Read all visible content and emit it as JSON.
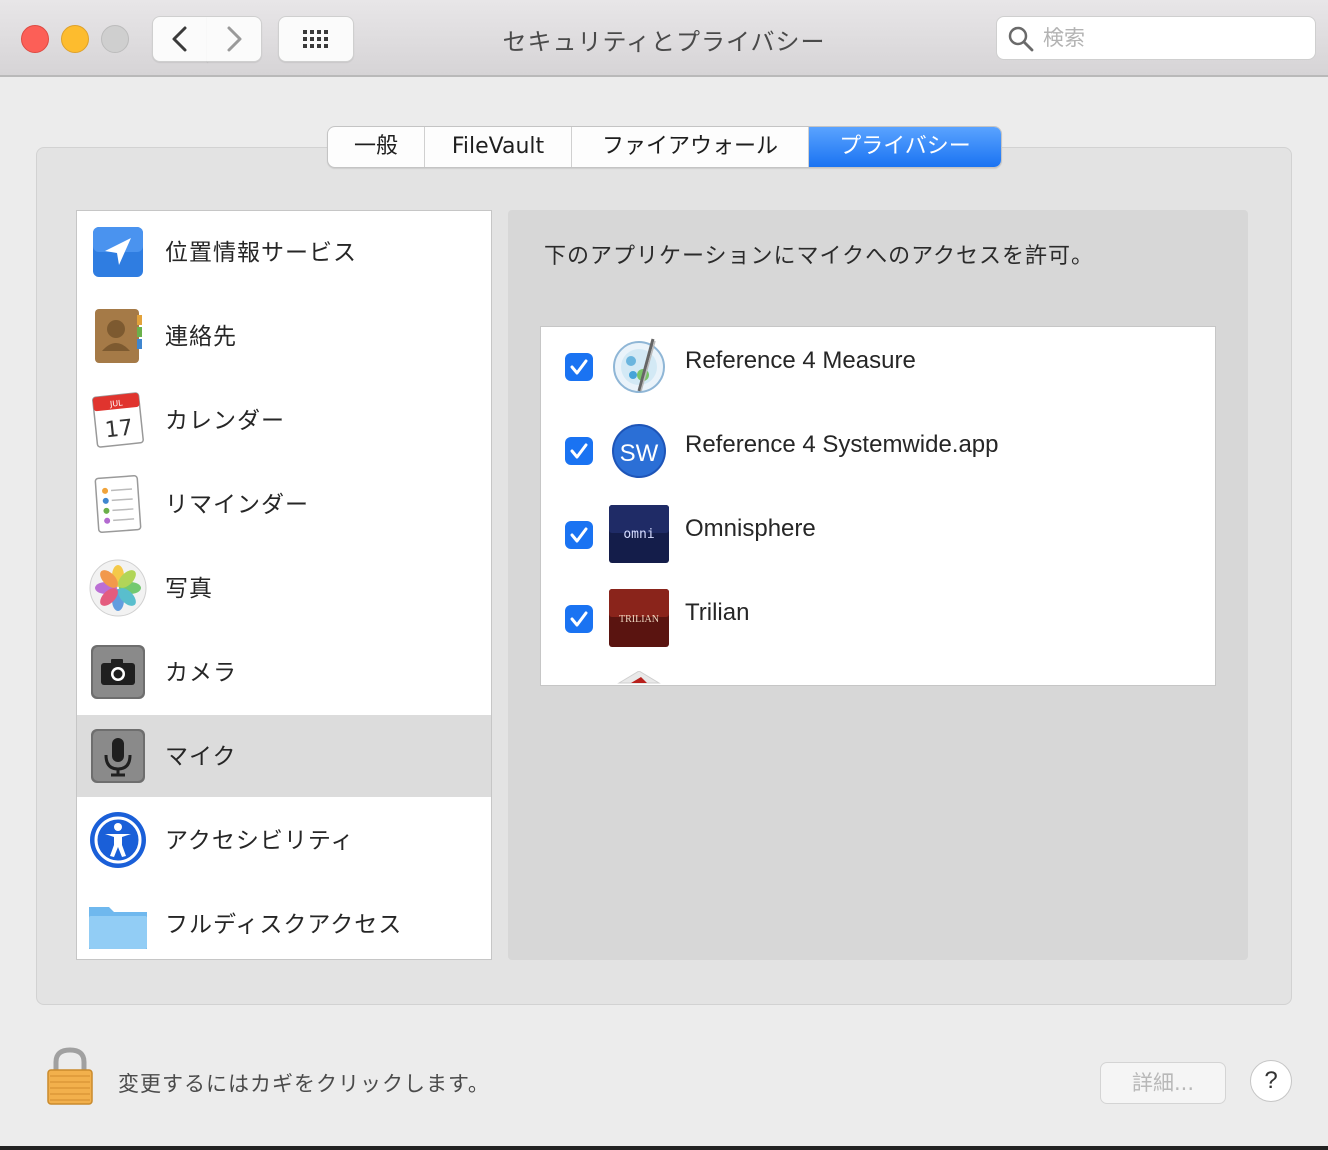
{
  "window": {
    "title": "セキュリティとプライバシー",
    "search_placeholder": "検索"
  },
  "tabs": [
    {
      "label": "一般",
      "active": false
    },
    {
      "label": "FileVault",
      "active": false
    },
    {
      "label": "ファイアウォール",
      "active": false
    },
    {
      "label": "プライバシー",
      "active": true
    }
  ],
  "categories": [
    {
      "label": "位置情報サービス",
      "icon": "location-arrow-icon"
    },
    {
      "label": "連絡先",
      "icon": "contacts-book-icon"
    },
    {
      "label": "カレンダー",
      "icon": "calendar-icon",
      "icon_text_month": "JUL",
      "icon_text_day": "17"
    },
    {
      "label": "リマインダー",
      "icon": "reminders-icon"
    },
    {
      "label": "写真",
      "icon": "photos-icon"
    },
    {
      "label": "カメラ",
      "icon": "camera-icon"
    },
    {
      "label": "マイク",
      "icon": "microphone-icon",
      "selected": true
    },
    {
      "label": "アクセシビリティ",
      "icon": "accessibility-icon"
    },
    {
      "label": "フルディスクアクセス",
      "icon": "folder-icon"
    }
  ],
  "panel": {
    "title": "下のアプリケーションにマイクへのアクセスを許可。",
    "apps": [
      {
        "name": "Reference 4 Measure",
        "checked": true,
        "icon": "reference-measure-icon"
      },
      {
        "name": "Reference 4 Systemwide.app",
        "checked": true,
        "icon": "systemwide-icon",
        "icon_text": "SW"
      },
      {
        "name": "Omnisphere",
        "checked": true,
        "icon": "omnisphere-icon",
        "icon_text": "omni"
      },
      {
        "name": "Trilian",
        "checked": true,
        "icon": "trilian-icon",
        "icon_text": "TRILIAN"
      }
    ]
  },
  "footer": {
    "lock_text": "変更するにはカギをクリックします。",
    "advanced_label": "詳細...",
    "help_label": "?"
  },
  "colors": {
    "accent": "#1a73f2",
    "close": "#fc5f57",
    "minimize": "#fdbc2e"
  }
}
